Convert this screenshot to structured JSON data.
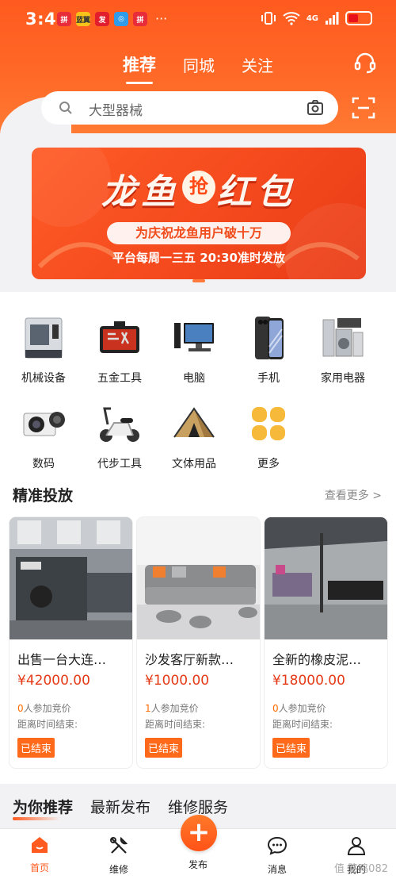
{
  "status_bar": {
    "time": "3:43",
    "app_icons": [
      "拼",
      "蓝翼",
      "发",
      "◎",
      "拼"
    ],
    "more": "···",
    "network": "4G",
    "battery_percent": 45
  },
  "top_tabs": [
    {
      "label": "推荐",
      "active": true
    },
    {
      "label": "同城",
      "active": false
    },
    {
      "label": "关注",
      "active": false
    }
  ],
  "search": {
    "placeholder": "大型器械"
  },
  "banner": {
    "title_left": "龙鱼",
    "title_mid": "抢",
    "title_right": "红包",
    "subtitle": "为庆祝龙鱼用户破十万",
    "line": "平台每周一三五  20:30准时发放"
  },
  "categories": [
    {
      "label": "机械设备",
      "icon": "cnc-machine-icon"
    },
    {
      "label": "五金工具",
      "icon": "toolbox-icon"
    },
    {
      "label": "电脑",
      "icon": "computer-icon"
    },
    {
      "label": "手机",
      "icon": "phone-icon"
    },
    {
      "label": "家用电器",
      "icon": "appliance-icon"
    },
    {
      "label": "数码",
      "icon": "camera-icon"
    },
    {
      "label": "代步工具",
      "icon": "scooter-icon"
    },
    {
      "label": "文体用品",
      "icon": "tent-icon"
    },
    {
      "label": "更多",
      "icon": "more-grid-icon"
    }
  ],
  "precise": {
    "title": "精准投放",
    "more": "查看更多 >",
    "items": [
      {
        "name": "出售一台大连…",
        "price": "¥42000.00",
        "bid_count": "0",
        "bid_text": "人参加竞价",
        "timer": "距离时间结束:",
        "status": "已结束"
      },
      {
        "name": "沙发客厅新款…",
        "price": "¥1000.00",
        "bid_count": "1",
        "bid_text": "人参加竞价",
        "timer": "距离时间结束:",
        "status": "已结束"
      },
      {
        "name": "全新的橡皮泥…",
        "price": "¥18000.00",
        "bid_count": "0",
        "bid_text": "人参加竞价",
        "timer": "距离时间结束:",
        "status": "已结束"
      }
    ]
  },
  "rec_tabs": [
    {
      "label": "为你推荐",
      "active": true
    },
    {
      "label": "最新发布",
      "active": false
    },
    {
      "label": "维修服务",
      "active": false
    }
  ],
  "bottom_nav": [
    {
      "label": "首页",
      "active": true
    },
    {
      "label": "维修",
      "active": false
    },
    {
      "label": "发布",
      "active": false
    },
    {
      "label": "消息",
      "active": false
    },
    {
      "label": "我的",
      "active": false
    }
  ],
  "watermark": "值 路鸣082",
  "colors": {
    "brand": "#ff5a1f",
    "price": "#e53a17",
    "ended": "#ff6a1a"
  }
}
